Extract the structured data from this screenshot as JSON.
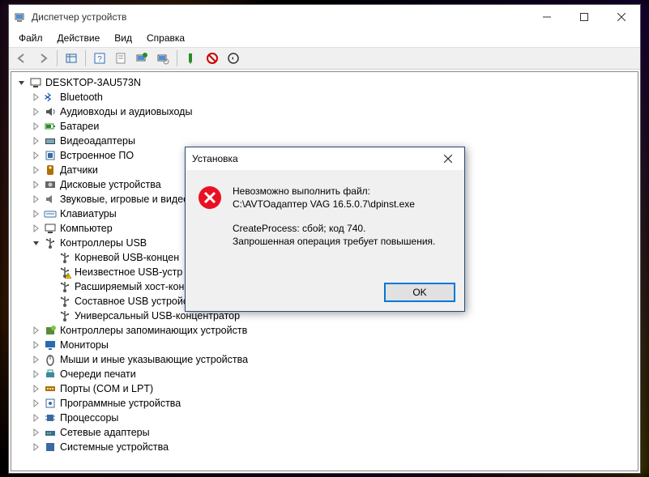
{
  "window": {
    "title": "Диспетчер устройств"
  },
  "menu": {
    "file": "Файл",
    "action": "Действие",
    "view": "Вид",
    "help": "Справка"
  },
  "tree": {
    "root": "DESKTOP-3AU573N",
    "items": [
      {
        "label": "Bluetooth"
      },
      {
        "label": "Аудиовходы и аудиовыходы"
      },
      {
        "label": "Батареи"
      },
      {
        "label": "Видеоадаптеры"
      },
      {
        "label": "Встроенное ПО"
      },
      {
        "label": "Датчики"
      },
      {
        "label": "Дисковые устройства"
      },
      {
        "label": "Звуковые, игровые и видео"
      },
      {
        "label": "Клавиатуры"
      },
      {
        "label": "Компьютер"
      },
      {
        "label": "Контроллеры USB",
        "expanded": true,
        "children": [
          {
            "label": "Корневой USB-концен"
          },
          {
            "label": "Неизвестное USB-устр",
            "warn": true
          },
          {
            "label": "Расширяемый хост-кон"
          },
          {
            "label": "Составное USB устройст"
          },
          {
            "label": "Универсальный USB-концентратор"
          }
        ]
      },
      {
        "label": "Контроллеры запоминающих устройств"
      },
      {
        "label": "Мониторы"
      },
      {
        "label": "Мыши и иные указывающие устройства"
      },
      {
        "label": "Очереди печати"
      },
      {
        "label": "Порты (COM и LPT)"
      },
      {
        "label": "Программные устройства"
      },
      {
        "label": "Процессоры"
      },
      {
        "label": "Сетевые адаптеры"
      },
      {
        "label": "Системные устройства"
      }
    ]
  },
  "dialog": {
    "title": "Установка",
    "line1": "Невозможно выполнить файл:",
    "line2": "C:\\AVTOадаптер VAG 16.5.0.7\\dpinst.exe",
    "line3": "CreateProcess: сбой; код 740.",
    "line4": "Запрошенная операция требует повышения.",
    "ok": "OK"
  },
  "icon_colors": {
    "bluetooth": "#0a4fb5",
    "audio": "#555",
    "battery": "#2a8a2a",
    "video": "#444",
    "firmware": "#3a6aa0",
    "sensor": "#b07000",
    "disk": "#666",
    "sound": "#777",
    "keyboard": "#3a6aa0",
    "computer": "#444",
    "usb": "#555",
    "storage": "#5a8a3a",
    "monitor": "#2a6ab0",
    "mouse": "#555",
    "printer": "#3a8a9a",
    "port": "#b07000",
    "software": "#3a6aa0",
    "cpu": "#3a6aa0",
    "network": "#3a6aa0",
    "system": "#3a6aa0"
  }
}
